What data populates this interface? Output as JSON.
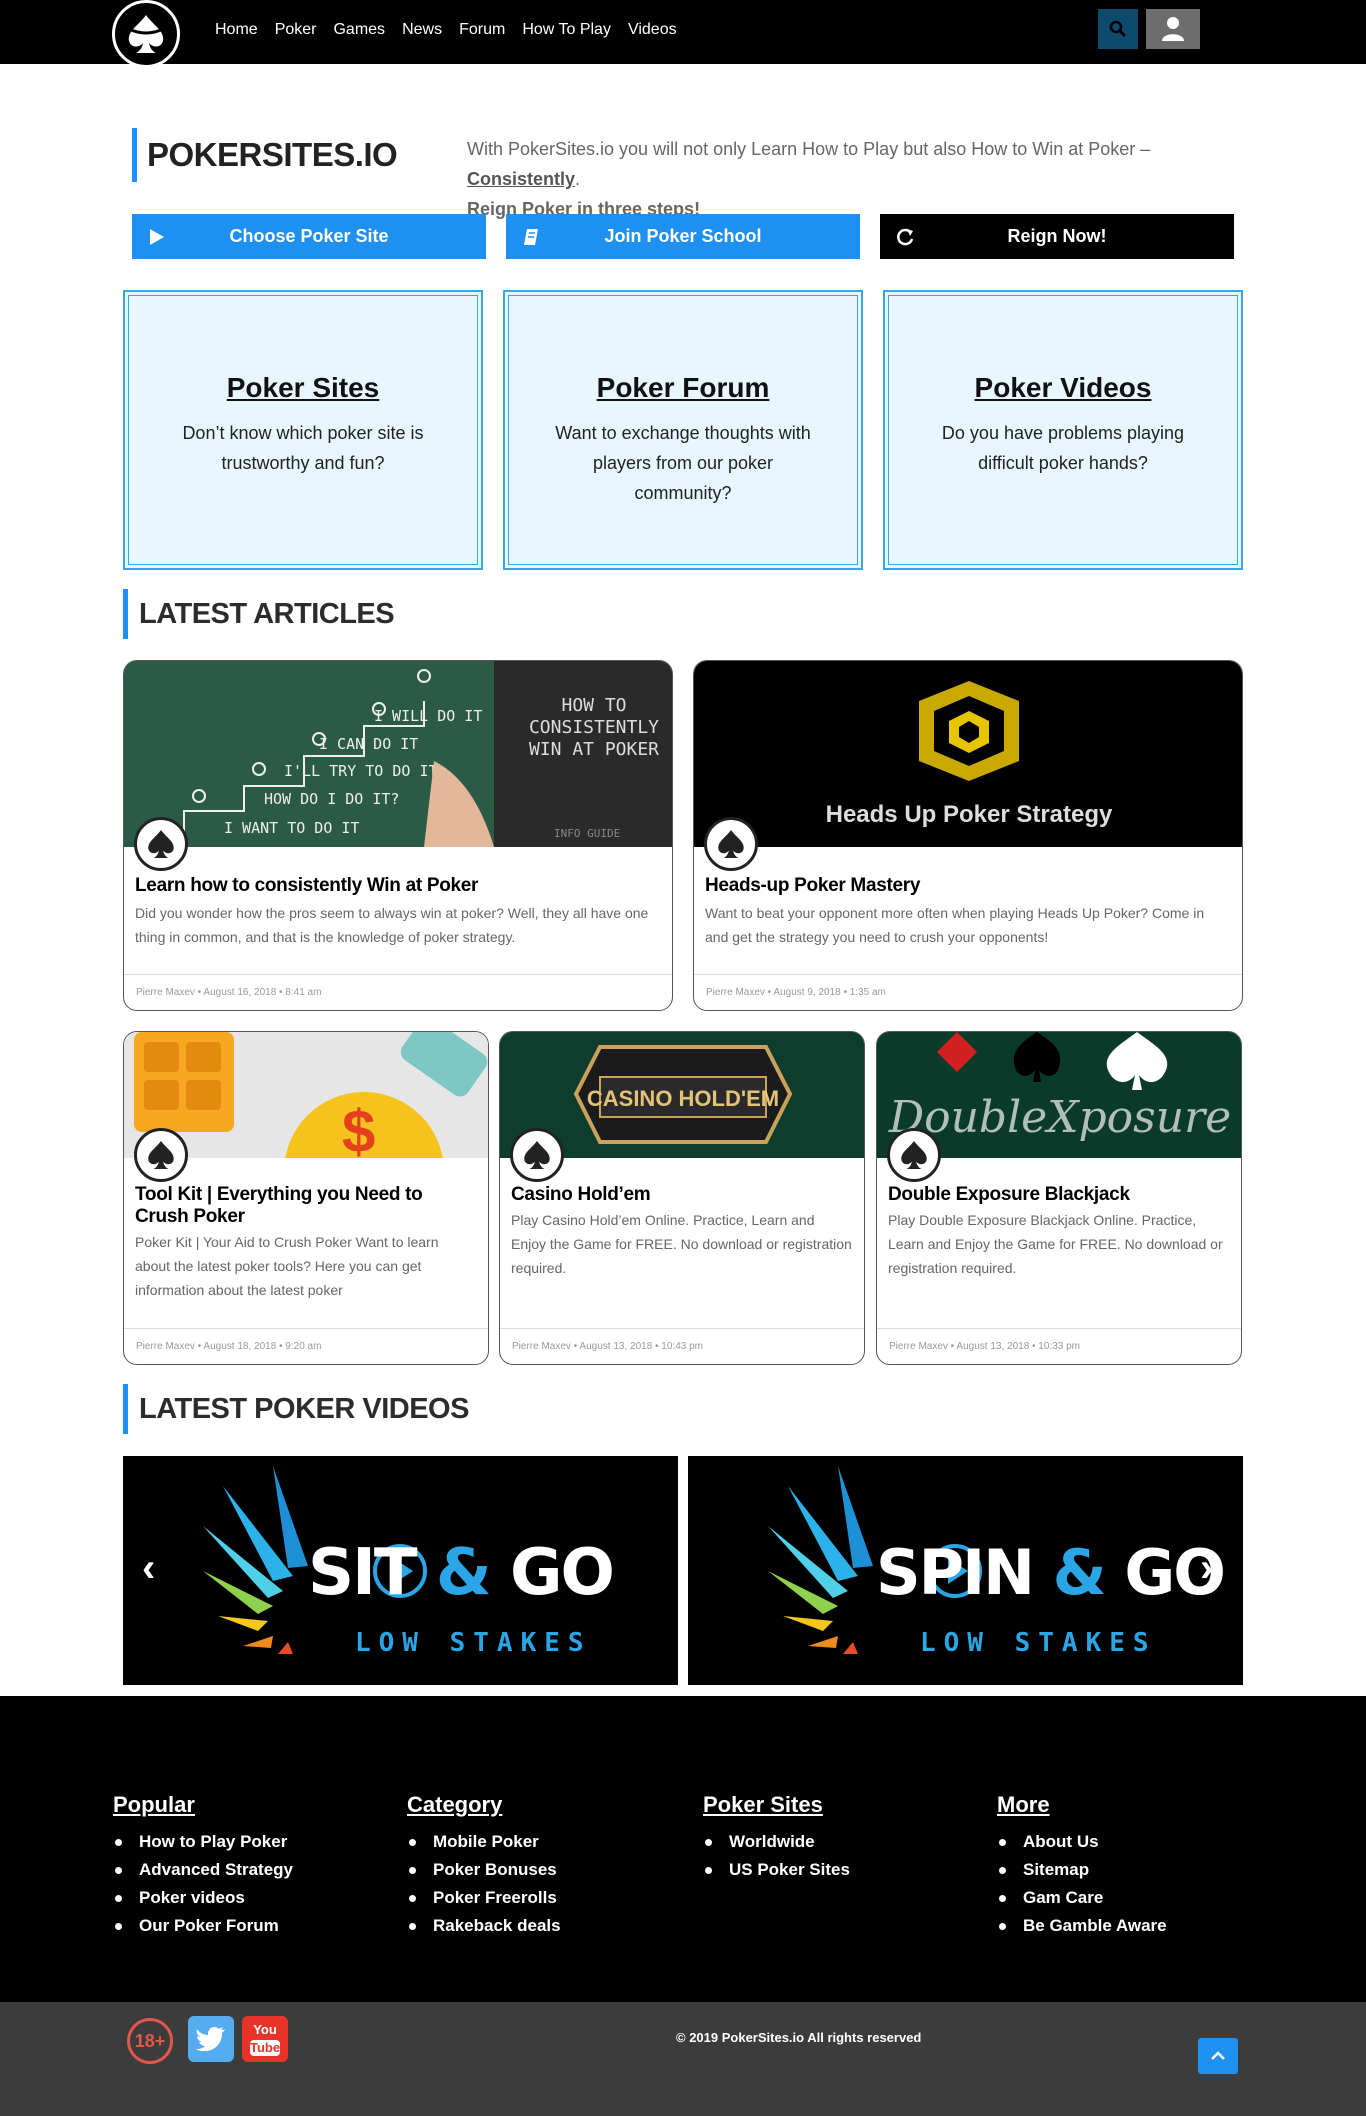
{
  "nav": [
    "Home",
    "Poker",
    "Games",
    "News",
    "Forum",
    "How To Play",
    "Videos"
  ],
  "brand": "POKERSITES.IO",
  "intro": {
    "text": "With PokerSites.io you will not only Learn How to Play but also How to Win at Poker – ",
    "emphasis": "Consistently",
    "end": ".",
    "lead": "Reign Poker in three steps!"
  },
  "cta": [
    {
      "label": "Choose Poker Site",
      "icon": "play-icon"
    },
    {
      "label": "Join Poker School",
      "icon": "book-icon"
    },
    {
      "label": "Reign Now!",
      "icon": "refresh-icon"
    }
  ],
  "features": [
    {
      "title": "Poker Sites",
      "text": "Don’t know which poker site is trustworthy and fun?"
    },
    {
      "title": "Poker Forum",
      "text": "Want to exchange thoughts with players from our poker community?"
    },
    {
      "title": "Poker Videos",
      "text": "Do you have problems playing difficult poker hands?"
    }
  ],
  "sections": {
    "articles": "LATEST ARTICLES",
    "videos": "LATEST POKER VIDEOS"
  },
  "articles": [
    {
      "title": "Learn how to consistently Win at Poker",
      "excerpt": "Did you wonder how the pros seem to always win at poker? Well, they all have one thing in common, and that is the knowledge of poker strategy.",
      "meta": "Pierre Maxev  •  August 16, 2018  •  8:41 am",
      "image_text": "HOW TO CONSISTENTLY WIN AT POKER",
      "image_sub": "INFO GUIDE"
    },
    {
      "title": "Heads-up Poker Mastery",
      "excerpt": "Want to beat your opponent more often when playing Heads Up Poker? Come in and get the strategy you need to crush your opponents!",
      "meta": "Pierre Maxev  •  August 9, 2018  •  1:35 am",
      "image_text": "Heads Up Poker Strategy"
    },
    {
      "title": "Tool Kit | Everything you Need to Crush Poker",
      "excerpt": "Poker Kit | Your Aid to Crush Poker Want to learn about the latest poker tools? Here you can get information about the latest poker",
      "meta": "Pierre Maxev  •  August 18, 2018  •  9:20 am"
    },
    {
      "title": "Casino Hold’em",
      "excerpt": "Play Casino Hold’em Online. Practice, Learn and Enjoy the Game for FREE. No download or registration required.",
      "meta": "Pierre Maxev  •  August 13, 2018  •  10:43 pm",
      "image_text": "CASINO HOLD'EM"
    },
    {
      "title": "Double Exposure Blackjack",
      "excerpt": "Play Double Exposure Blackjack Online. Practice, Learn and Enjoy the Game for FREE. No download or registration required.",
      "meta": "Pierre Maxev  •  August 13, 2018  •  10:33 pm",
      "image_text": "DoubleXposure"
    }
  ],
  "videos": [
    {
      "word1": "SIT",
      "amp": "&",
      "word2": "GO",
      "sub": "LOW STAKES"
    },
    {
      "word1": "SPIN",
      "amp": "&",
      "word2": "GO",
      "sub": "LOW STAKES"
    }
  ],
  "footer": {
    "cols": [
      {
        "title": "Popular",
        "items": [
          "How to Play Poker",
          "Advanced Strategy",
          "Poker videos",
          "Our Poker Forum"
        ]
      },
      {
        "title": "Category",
        "items": [
          "Mobile Poker",
          "Poker Bonuses",
          "Poker Freerolls",
          "Rakeback deals"
        ]
      },
      {
        "title": "Poker Sites",
        "items": [
          "Worldwide",
          "US Poker Sites"
        ]
      },
      {
        "title": "More",
        "items": [
          "About Us",
          "Sitemap",
          "Gam Care",
          "Be Gamble Aware"
        ]
      }
    ],
    "copyright": "© 2019 PokerSites.io All rights reserved",
    "badges": {
      "age": "18+",
      "youtube_top": "You",
      "youtube_bottom": "Tube"
    }
  },
  "colors": {
    "accent": "#1e90ef",
    "box_bg": "#e8f6ff",
    "box_border": "#39a7e6",
    "dark": "#000000"
  }
}
